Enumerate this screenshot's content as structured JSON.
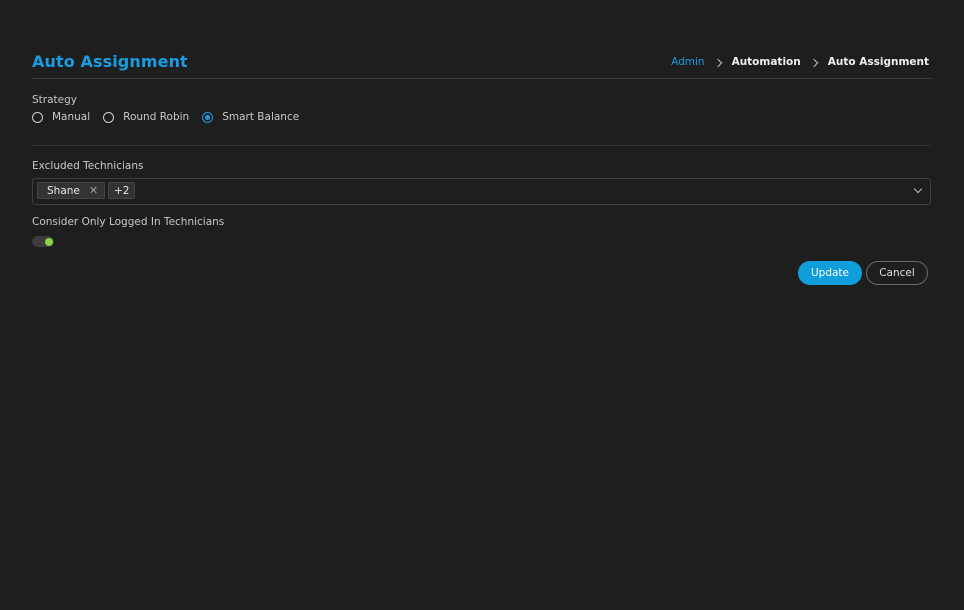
{
  "header": {
    "title": "Auto Assignment",
    "breadcrumb": [
      "Admin",
      "Automation",
      "Auto Assignment"
    ]
  },
  "strategy": {
    "label": "Strategy",
    "options": [
      "Manual",
      "Round Robin",
      "Smart Balance"
    ],
    "selected": "Smart Balance"
  },
  "excluded": {
    "label": "Excluded Technicians",
    "tags": [
      "Shane"
    ],
    "more": "+2"
  },
  "logged_in": {
    "label": "Consider Only Logged In Technicians",
    "enabled": true
  },
  "actions": {
    "update": "Update",
    "cancel": "Cancel"
  },
  "colors": {
    "accent": "#1a9de0",
    "toggle_on": "#8bd44a",
    "background": "#1e1e1e"
  },
  "icons": {
    "breadcrumb_separator": "chevron-right-icon",
    "tag_remove": "close-icon",
    "dropdown": "chevron-down-icon"
  }
}
